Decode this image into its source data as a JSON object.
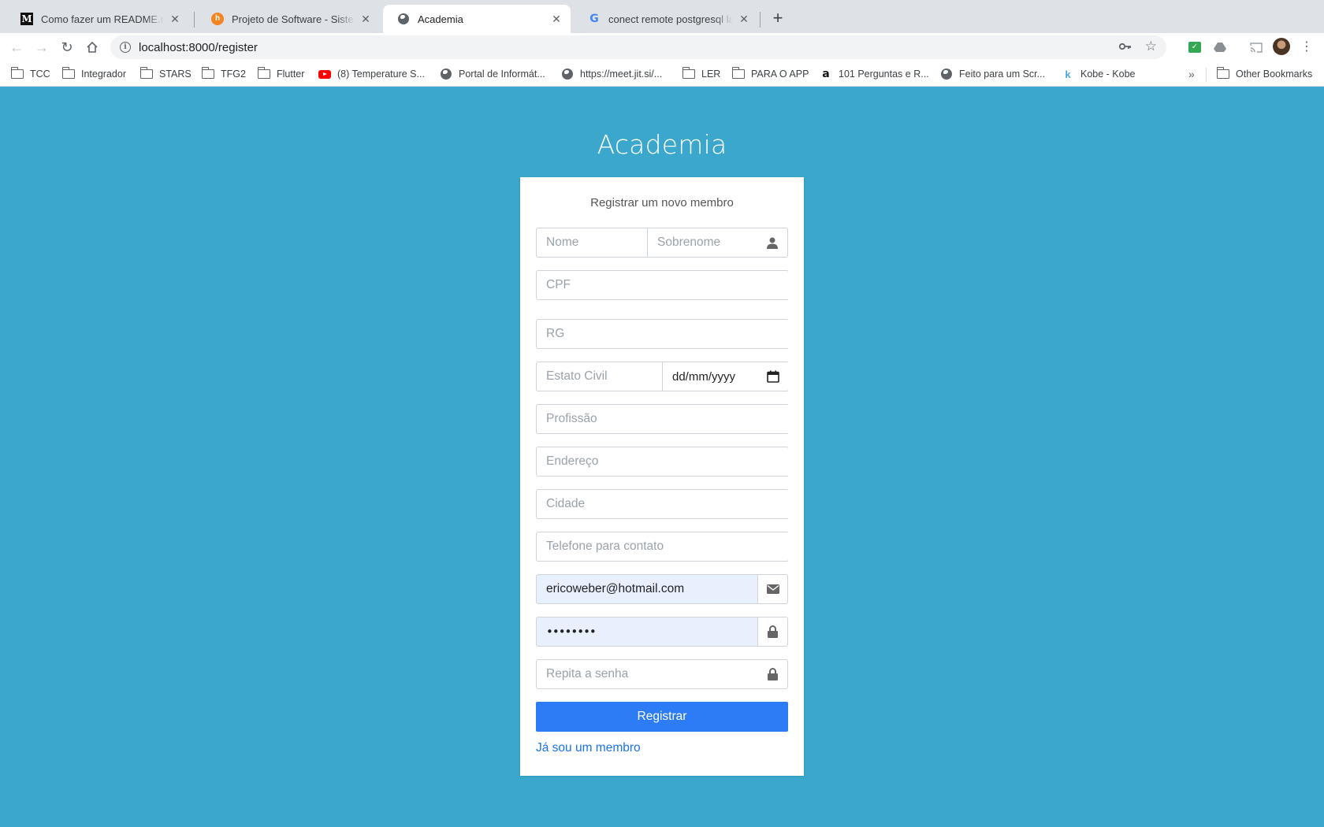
{
  "browser": {
    "tabs": [
      {
        "title": "Como fazer um README.md BONITÃO",
        "icon": "medium-icon"
      },
      {
        "title": "Projeto de Software - Sistema de Gerenciamento",
        "icon": "hackmd-icon"
      },
      {
        "title": "Academia",
        "icon": "globe-icon",
        "active": true
      },
      {
        "title": "conect remote postgresql laravel - Google Search",
        "icon": "google-icon"
      }
    ],
    "url": "localhost:8000/register",
    "bookmarks": [
      {
        "label": "TCC",
        "icon": "folder-icon"
      },
      {
        "label": "Integrador",
        "icon": "folder-icon"
      },
      {
        "label": "STARS",
        "icon": "folder-icon"
      },
      {
        "label": "TFG2",
        "icon": "folder-icon"
      },
      {
        "label": "Flutter",
        "icon": "folder-icon"
      },
      {
        "label": "(8) Temperature S...",
        "icon": "youtube-icon"
      },
      {
        "label": "Portal de Informát...",
        "icon": "globe-icon"
      },
      {
        "label": "https://meet.jit.si/...",
        "icon": "globe-icon"
      },
      {
        "label": "LER",
        "icon": "folder-icon"
      },
      {
        "label": "PARA O APP",
        "icon": "folder-icon"
      },
      {
        "label": "101 Perguntas e R...",
        "icon": "amazon-icon"
      },
      {
        "label": "Feito para um Scr...",
        "icon": "globe-icon"
      },
      {
        "label": "Kobe - Kobe",
        "icon": "kobe-icon"
      }
    ],
    "other_bookmarks": "Other Bookmarks"
  },
  "page": {
    "app_title": "Academia",
    "subtitle": "Registrar um novo membro",
    "fields": {
      "nome": {
        "placeholder": "Nome"
      },
      "sobrenome": {
        "placeholder": "Sobrenome"
      },
      "cpf": {
        "placeholder": "CPF"
      },
      "rg": {
        "placeholder": "RG"
      },
      "estado_civil": {
        "placeholder": "Estato Civil"
      },
      "data_nascimento": {
        "placeholder": "dd/mm/yyyy"
      },
      "profissao": {
        "placeholder": "Profissão"
      },
      "endereco": {
        "placeholder": "Endereço"
      },
      "cidade": {
        "placeholder": "Cidade"
      },
      "telefone": {
        "placeholder": "Telefone para contato"
      },
      "email": {
        "value": "ericoweber@hotmail.com"
      },
      "senha": {
        "value": "••••••••"
      },
      "repita_senha": {
        "placeholder": "Repita a senha"
      }
    },
    "register_button": "Registrar",
    "login_link": "Já sou um membro"
  },
  "colors": {
    "page_background": "#3ba7cc",
    "primary_button": "#2c7cf6",
    "link": "#1a73e8",
    "autofill": "#e8f0fe"
  }
}
